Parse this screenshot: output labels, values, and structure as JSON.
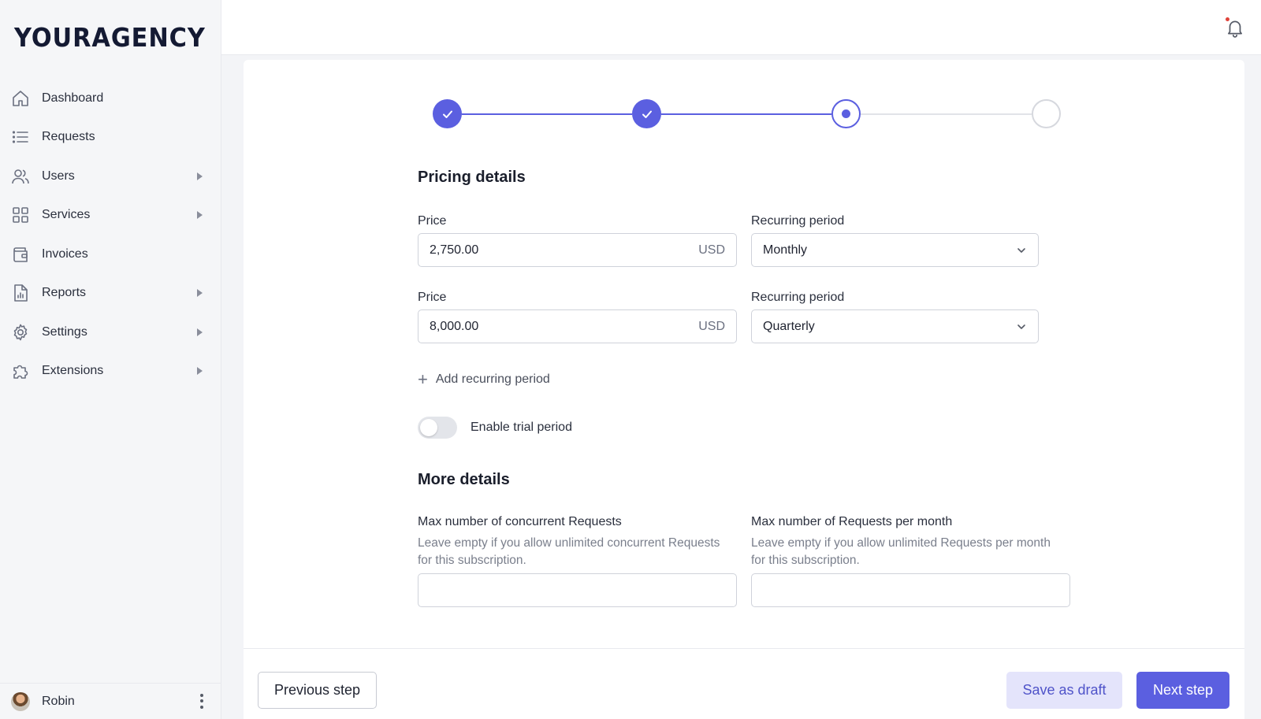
{
  "app": {
    "logo": "YOURAGENCY"
  },
  "sidebar": {
    "items": [
      {
        "label": "Dashboard",
        "icon": "home-icon",
        "has_submenu": false
      },
      {
        "label": "Requests",
        "icon": "list-icon",
        "has_submenu": false
      },
      {
        "label": "Users",
        "icon": "users-icon",
        "has_submenu": true
      },
      {
        "label": "Services",
        "icon": "grid-icon",
        "has_submenu": true
      },
      {
        "label": "Invoices",
        "icon": "wallet-icon",
        "has_submenu": false
      },
      {
        "label": "Reports",
        "icon": "report-icon",
        "has_submenu": true
      },
      {
        "label": "Settings",
        "icon": "gear-icon",
        "has_submenu": true
      },
      {
        "label": "Extensions",
        "icon": "puzzle-icon",
        "has_submenu": true
      }
    ],
    "user": {
      "name": "Robin"
    }
  },
  "topbar": {
    "notification_icon": "bell-icon",
    "has_unread": true
  },
  "stepper": {
    "steps": [
      "done",
      "done",
      "current",
      "todo"
    ]
  },
  "pricing": {
    "title": "Pricing details",
    "rows": [
      {
        "price_label": "Price",
        "price_value": "2,750.00",
        "currency": "USD",
        "period_label": "Recurring period",
        "period_value": "Monthly"
      },
      {
        "price_label": "Price",
        "price_value": "8,000.00",
        "currency": "USD",
        "period_label": "Recurring period",
        "period_value": "Quarterly"
      }
    ],
    "add_period_label": "Add recurring period",
    "trial_label": "Enable trial period",
    "trial_enabled": false
  },
  "more_details": {
    "title": "More details",
    "concurrent": {
      "label": "Max number of concurrent Requests",
      "help_line1": "Leave empty if you allow unlimited concurrent Requests",
      "help_line2": "for this subscription.",
      "value": ""
    },
    "per_month": {
      "label": "Max number of Requests per month",
      "help_line1": "Leave empty if you allow unlimited Requests per month",
      "help_line2": "for this subscription.",
      "value": ""
    }
  },
  "footer": {
    "previous_label": "Previous step",
    "draft_label": "Save as draft",
    "next_label": "Next step"
  },
  "colors": {
    "accent": "#5b5fe0",
    "accent_light": "#e4e4fb",
    "sidebar_bg": "#f5f6f8"
  }
}
